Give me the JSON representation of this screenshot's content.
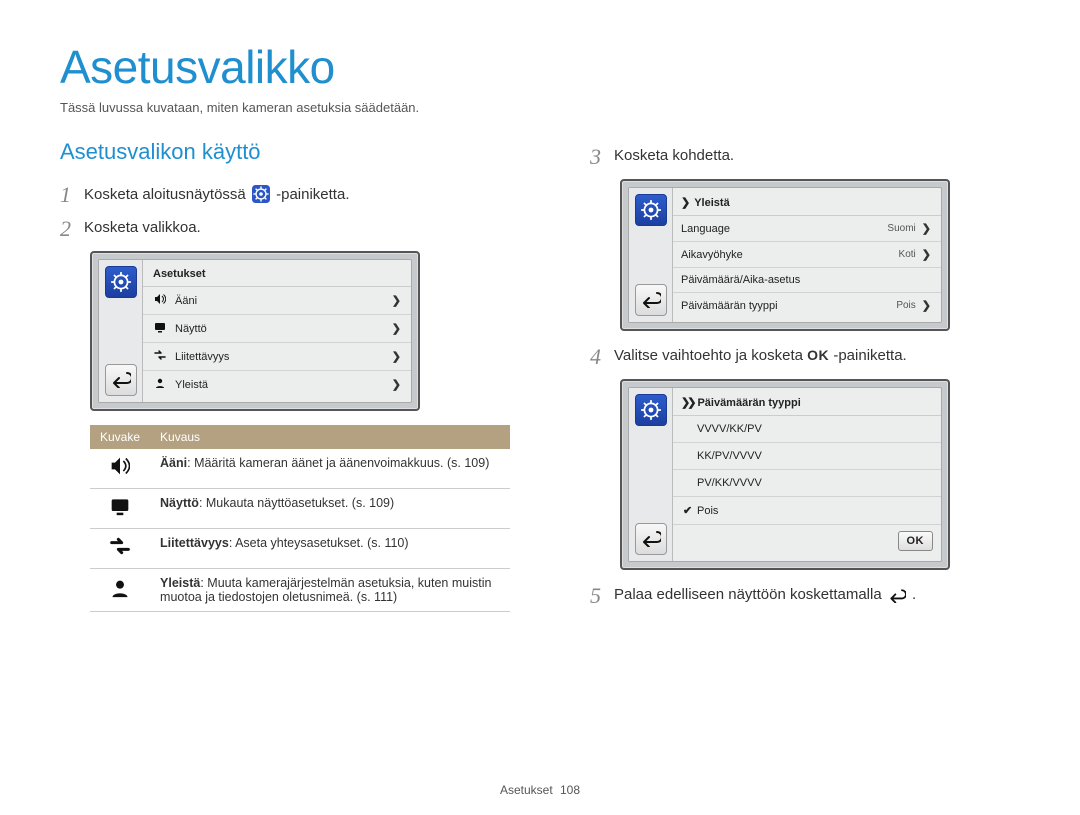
{
  "page_title": "Asetusvalikko",
  "page_subtitle": "Tässä luvussa kuvataan, miten kameran asetuksia säädetään.",
  "section_heading": "Asetusvalikon käyttö",
  "steps": {
    "s1_pre": "Kosketa aloitusnäytössä ",
    "s1_post": "-painiketta.",
    "s2": "Kosketa valikkoa.",
    "s3": "Kosketa kohdetta.",
    "s4_pre": "Valitse vaihtoehto ja kosketa ",
    "s4_post": "-painiketta.",
    "s5_pre": "Palaa edelliseen näyttöön koskettamalla ",
    "s5_post": "."
  },
  "screen_a": {
    "header": "Asetukset",
    "rows": [
      {
        "label": "Ääni"
      },
      {
        "label": "Näyttö"
      },
      {
        "label": "Liitettävyys"
      },
      {
        "label": "Yleistä"
      }
    ]
  },
  "screen_b": {
    "header": "Yleistä",
    "rows": [
      {
        "label": "Language",
        "value": "Suomi",
        "chev": true
      },
      {
        "label": "Aikavyöhyke",
        "value": "Koti",
        "chev": true
      },
      {
        "label": "Päivämäärä/Aika-asetus",
        "value": "",
        "chev": false
      },
      {
        "label": "Päivämäärän tyyppi",
        "value": "Pois",
        "chev": true
      }
    ]
  },
  "screen_c": {
    "header": "Päivämäärän tyyppi",
    "options": [
      {
        "label": "VVVV/KK/PV",
        "checked": false
      },
      {
        "label": "KK/PV/VVVV",
        "checked": false
      },
      {
        "label": "PV/KK/VVVV",
        "checked": false
      },
      {
        "label": "Pois",
        "checked": true
      }
    ],
    "ok": "OK"
  },
  "desc_table": {
    "head_icon": "Kuvake",
    "head_desc": "Kuvaus",
    "rows": [
      {
        "icon": "speaker",
        "bold": "Ääni",
        "text": ": Määritä kameran äänet ja äänenvoimakkuus. (s. 109)"
      },
      {
        "icon": "display",
        "bold": "Näyttö",
        "text": ": Mukauta näyttöasetukset. (s. 109)"
      },
      {
        "icon": "connect",
        "bold": "Liitettävyys",
        "text": ": Aseta yhteysasetukset. (s. 110)"
      },
      {
        "icon": "person",
        "bold": "Yleistä",
        "text": ": Muuta kamerajärjestelmän asetuksia, kuten muistin muotoa ja tiedostojen oletusnimeä. (s. 111)"
      }
    ]
  },
  "footer_label": "Asetukset",
  "footer_page": "108",
  "glyphs": {
    "ok": "OK",
    "chev_right": "❯",
    "chev_right_dbl": "❯❯",
    "check": "✔"
  }
}
